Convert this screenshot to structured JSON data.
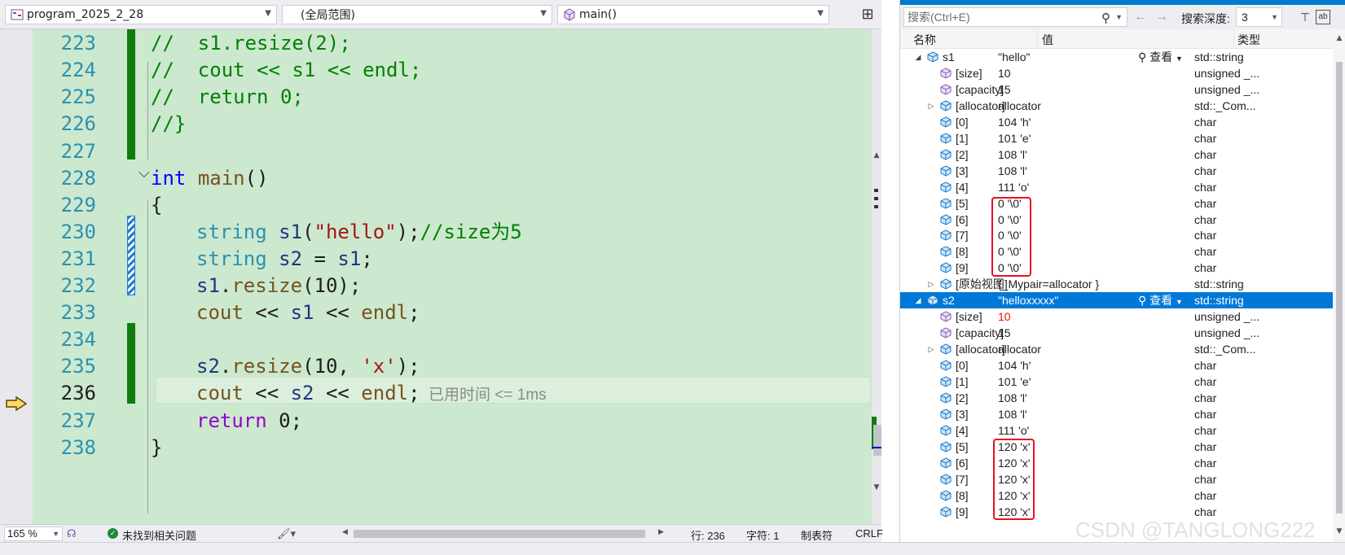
{
  "nav": {
    "project": "program_2025_2_28",
    "scope": "(全局范围)",
    "member": "main()"
  },
  "code_lines": [
    {
      "num": "223"
    },
    {
      "num": "224"
    },
    {
      "num": "225"
    },
    {
      "num": "226"
    },
    {
      "num": "227"
    },
    {
      "num": "228"
    },
    {
      "num": "229"
    },
    {
      "num": "230"
    },
    {
      "num": "231"
    },
    {
      "num": "232"
    },
    {
      "num": "233"
    },
    {
      "num": "234"
    },
    {
      "num": "235"
    },
    {
      "num": "236"
    },
    {
      "num": "237"
    },
    {
      "num": "238"
    }
  ],
  "code_text": {
    "l223": "//  s1.resize(2);",
    "l224": "//  cout << s1 << endl;",
    "l225": "//  return 0;",
    "l226": "//}",
    "l228_kw": "int",
    "l228_fn": "main",
    "l228_rest": "()",
    "l229": "{",
    "l230_ty": "string",
    "l230_var": "s1",
    "l230_p1": "(",
    "l230_str": "\"hello\"",
    "l230_p2": ");",
    "l230_cm": "//size为5",
    "l231_ty": "string",
    "l231_var": "s2",
    "l231_eq": " = ",
    "l231_var2": "s1",
    "l231_end": ";",
    "l232_var": "s1",
    "l232_dot": ".",
    "l232_fn": "resize",
    "l232_p1": "(",
    "l232_num": "10",
    "l232_p2": ");",
    "l233_fn": "cout",
    "l233_op": " << ",
    "l233_var": "s1",
    "l233_op2": " << ",
    "l233_fn2": "endl",
    "l233_end": ";",
    "l235_var": "s2",
    "l235_dot": ".",
    "l235_fn": "resize",
    "l235_p1": "(",
    "l235_num": "10",
    "l235_comma": ", ",
    "l235_chr": "'x'",
    "l235_p2": ");",
    "l236_fn": "cout",
    "l236_op": " << ",
    "l236_var": "s2",
    "l236_op2": " << ",
    "l236_fn2": "endl",
    "l236_end": ";",
    "l237_kw": "return",
    "l237_num": " 0",
    "l237_end": ";",
    "l238": "}"
  },
  "elapsed_hint": "已用时间 <= 1ms",
  "status": {
    "zoom": "165 %",
    "issues": "未找到相关问题",
    "line": "行: 236",
    "char": "字符: 1",
    "tabs": "制表符",
    "eol": "CRLF"
  },
  "watch": {
    "search_placeholder": "搜索(Ctrl+E)",
    "depth_label": "搜索深度:",
    "depth_value": "3",
    "col_name": "名称",
    "col_value": "值",
    "col_type": "类型",
    "view_label": "查看",
    "rows": [
      {
        "name": "s1",
        "value": "\"hello\"",
        "type": "std::string"
      },
      {
        "name": "[size]",
        "value": "10",
        "type": "unsigned _..."
      },
      {
        "name": "[capacity]",
        "value": "15",
        "type": "unsigned _..."
      },
      {
        "name": "[allocator]",
        "value": "allocator",
        "type": "std::_Com..."
      },
      {
        "name": "[0]",
        "value": "104 'h'",
        "type": "char"
      },
      {
        "name": "[1]",
        "value": "101 'e'",
        "type": "char"
      },
      {
        "name": "[2]",
        "value": "108 'l'",
        "type": "char"
      },
      {
        "name": "[3]",
        "value": "108 'l'",
        "type": "char"
      },
      {
        "name": "[4]",
        "value": "111 'o'",
        "type": "char"
      },
      {
        "name": "[5]",
        "value": "0 '\\0'",
        "type": "char"
      },
      {
        "name": "[6]",
        "value": "0 '\\0'",
        "type": "char"
      },
      {
        "name": "[7]",
        "value": "0 '\\0'",
        "type": "char"
      },
      {
        "name": "[8]",
        "value": "0 '\\0'",
        "type": "char"
      },
      {
        "name": "[9]",
        "value": "0 '\\0'",
        "type": "char"
      },
      {
        "name": "[原始视图]",
        "value": "{_Mypair=allocator }",
        "type": "std::string"
      },
      {
        "name": "s2",
        "value": "\"helloxxxxx\"",
        "type": "std::string"
      },
      {
        "name": "[size]",
        "value": "10",
        "type": "unsigned _..."
      },
      {
        "name": "[capacity]",
        "value": "15",
        "type": "unsigned _..."
      },
      {
        "name": "[allocator]",
        "value": "allocator",
        "type": "std::_Com..."
      },
      {
        "name": "[0]",
        "value": "104 'h'",
        "type": "char"
      },
      {
        "name": "[1]",
        "value": "101 'e'",
        "type": "char"
      },
      {
        "name": "[2]",
        "value": "108 'l'",
        "type": "char"
      },
      {
        "name": "[3]",
        "value": "108 'l'",
        "type": "char"
      },
      {
        "name": "[4]",
        "value": "111 'o'",
        "type": "char"
      },
      {
        "name": "[5]",
        "value": "120 'x'",
        "type": "char"
      },
      {
        "name": "[6]",
        "value": "120 'x'",
        "type": "char"
      },
      {
        "name": "[7]",
        "value": "120 'x'",
        "type": "char"
      },
      {
        "name": "[8]",
        "value": "120 'x'",
        "type": "char"
      },
      {
        "name": "[9]",
        "value": "120 'x'",
        "type": "char"
      }
    ]
  },
  "watermark": "CSDN @TANGLONG222",
  "colors": {
    "editor_bg": "#cce8cf",
    "selection": "#0078d7",
    "changed_value": "#e51400",
    "highlight_box": "#e81123",
    "change_bar": "#107c10"
  }
}
